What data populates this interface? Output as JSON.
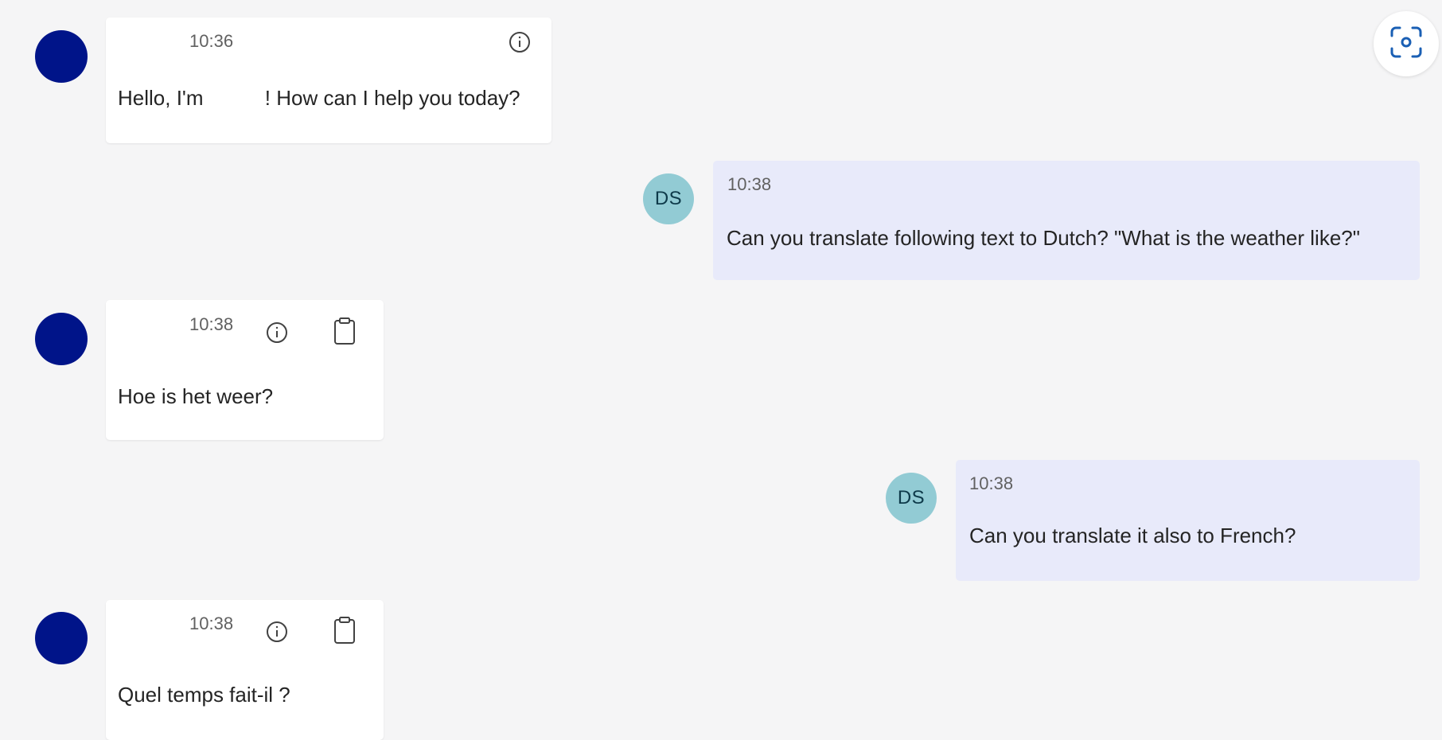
{
  "messages": [
    {
      "sender": "bot",
      "time": "10:36",
      "text_before_name": "Hello, I'm ",
      "text_after_name": "! How can I help you today?",
      "icons": [
        "info-icon"
      ]
    },
    {
      "sender": "user",
      "initials": "DS",
      "time": "10:38",
      "text": "Can you translate following text to Dutch? \"What is the weather like?\""
    },
    {
      "sender": "bot",
      "time": "10:38",
      "text": "Hoe is het weer?",
      "icons": [
        "info-icon",
        "clipboard-icon"
      ]
    },
    {
      "sender": "user",
      "initials": "DS",
      "time": "10:38",
      "text": "Can you translate it also to French?"
    },
    {
      "sender": "bot",
      "time": "10:38",
      "text": "Quel temps fait-il ?",
      "icons": [
        "info-icon",
        "clipboard-icon"
      ]
    }
  ],
  "toolbar": {
    "screenshot_icon": "screenshot-scan-icon"
  },
  "colors": {
    "background": "#f5f5f6",
    "bot_avatar": "#001489",
    "user_avatar": "#92cbd4",
    "bot_bubble": "#ffffff",
    "user_bubble": "#e8eafa",
    "accent": "#1a5fb4"
  }
}
